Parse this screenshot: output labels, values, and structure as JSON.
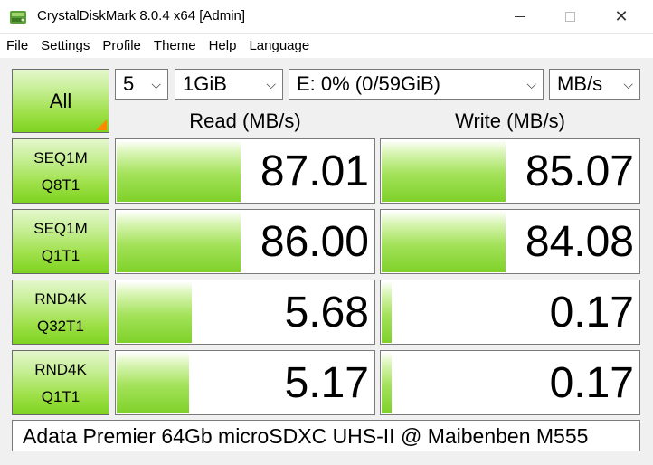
{
  "window": {
    "title": "CrystalDiskMark 8.0.4 x64 [Admin]",
    "close_glyph": "✕"
  },
  "menu": [
    "File",
    "Settings",
    "Profile",
    "Theme",
    "Help",
    "Language"
  ],
  "controls": {
    "all_label": "All",
    "count": "5",
    "size": "1GiB",
    "drive": "E: 0% (0/59GiB)",
    "unit": "MB/s",
    "chevron": "⌵"
  },
  "headers": {
    "read": "Read (MB/s)",
    "write": "Write (MB/s)"
  },
  "tests": [
    {
      "line1": "SEQ1M",
      "line2": "Q8T1",
      "read": "87.01",
      "write": "85.07",
      "read_fill": 0.48,
      "write_fill": 0.48
    },
    {
      "line1": "SEQ1M",
      "line2": "Q1T1",
      "read": "86.00",
      "write": "84.08",
      "read_fill": 0.48,
      "write_fill": 0.48
    },
    {
      "line1": "RND4K",
      "line2": "Q32T1",
      "read": "5.68",
      "write": "0.17",
      "read_fill": 0.29,
      "write_fill": 0.04
    },
    {
      "line1": "RND4K",
      "line2": "Q1T1",
      "read": "5.17",
      "write": "0.17",
      "read_fill": 0.28,
      "write_fill": 0.04
    }
  ],
  "comment": "Adata Premier 64Gb microSDXC UHS-II @ Maibenben M555",
  "colors": {
    "accent_green": "#7ed321",
    "corner_orange": "#ff8a00"
  }
}
